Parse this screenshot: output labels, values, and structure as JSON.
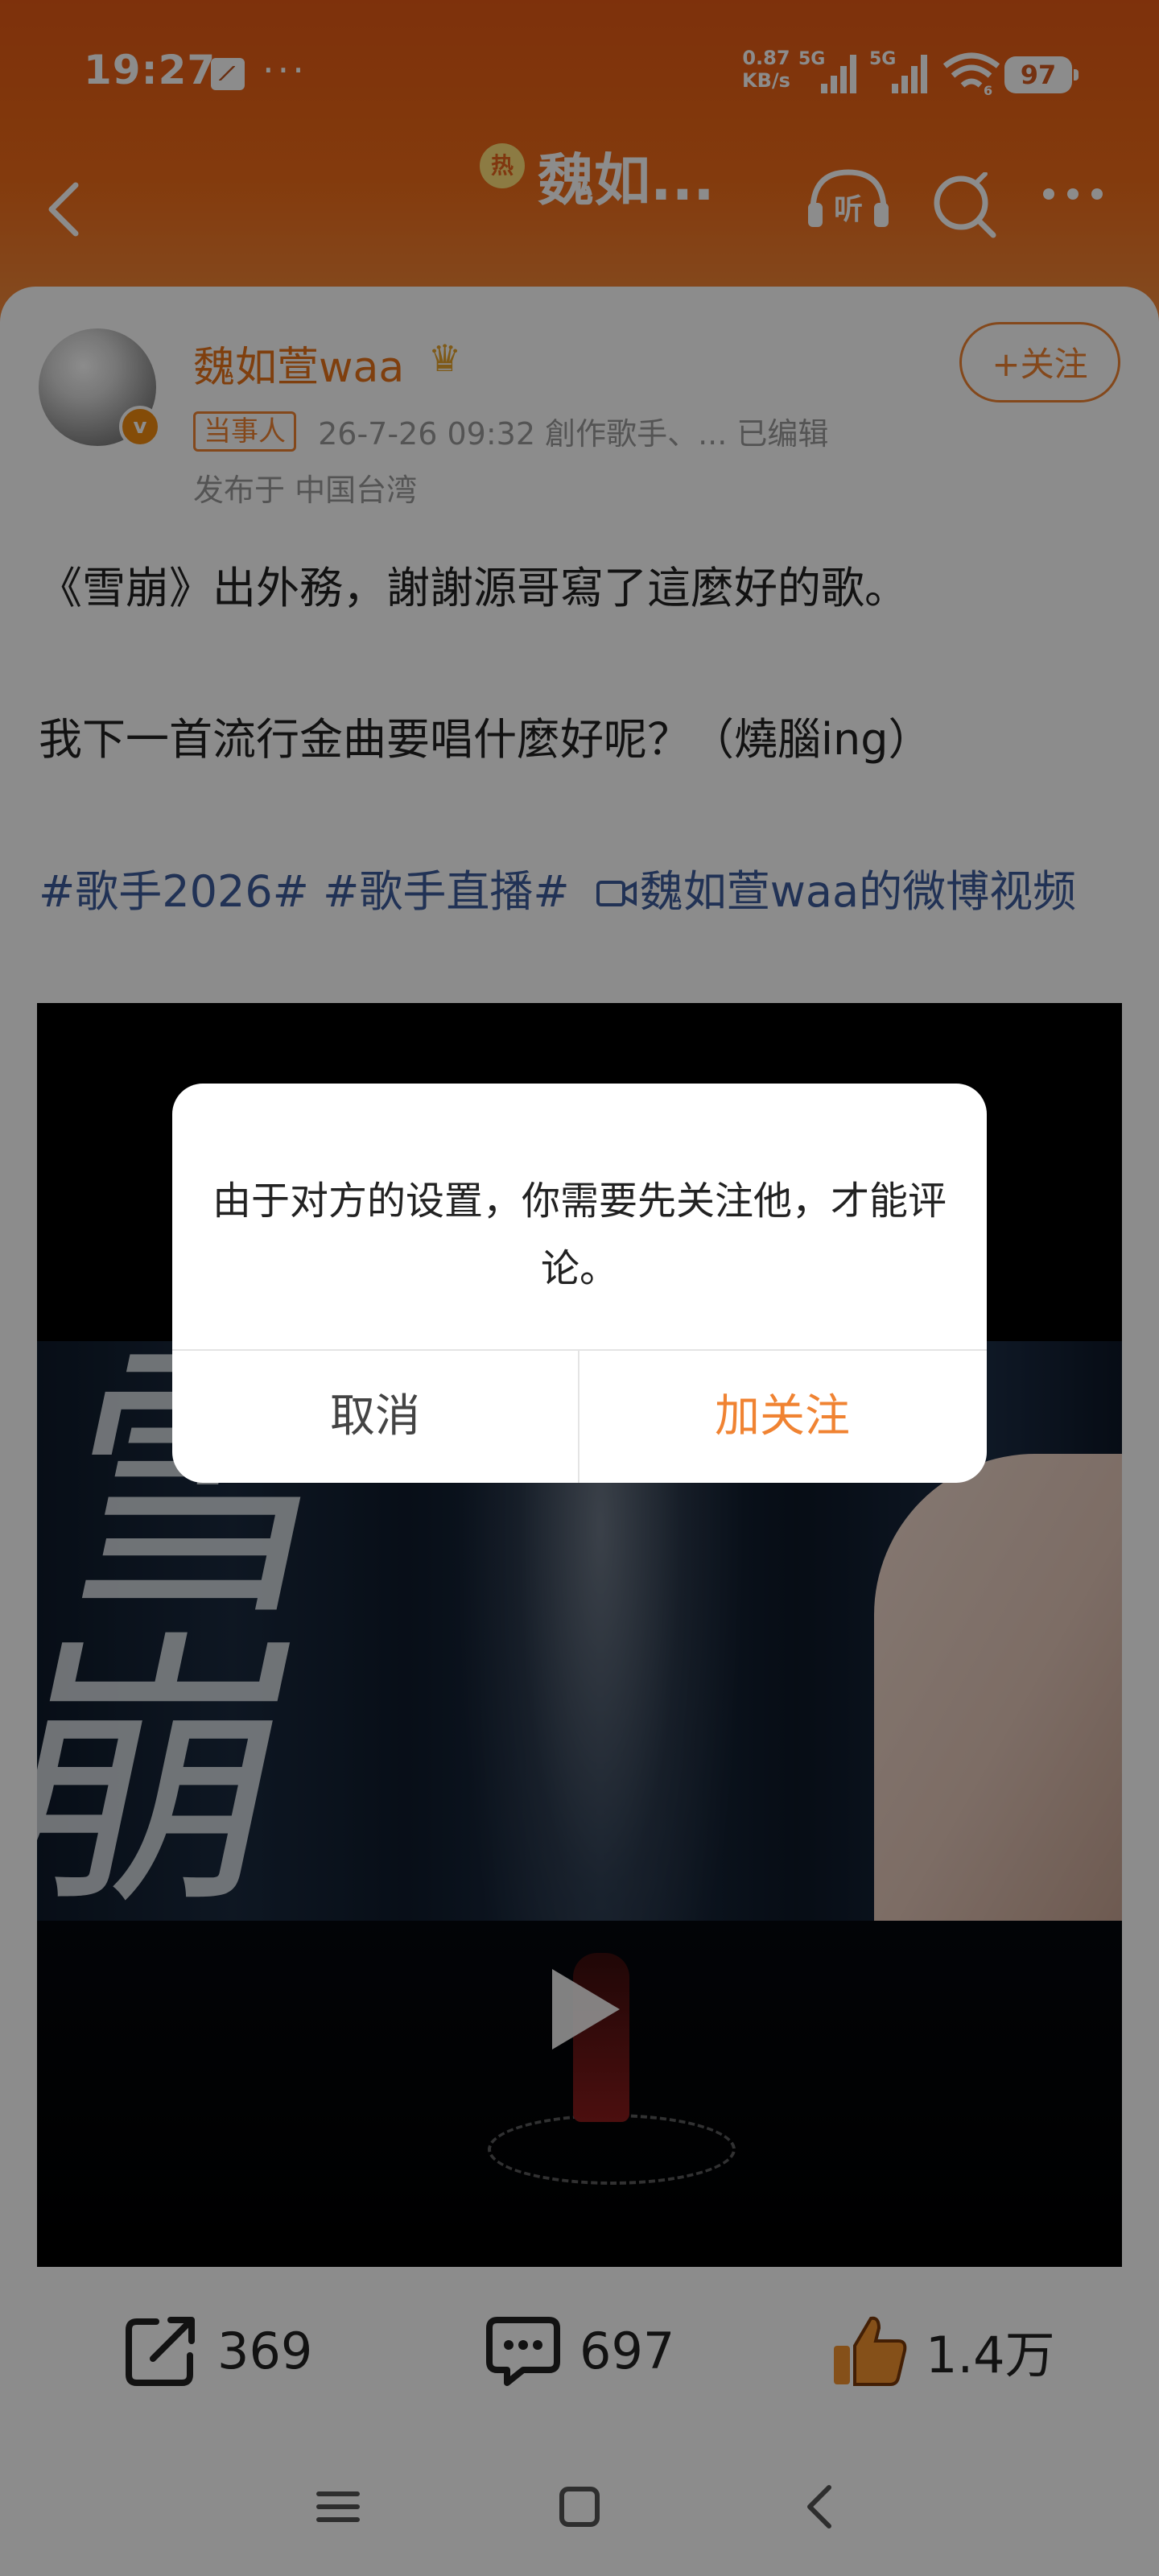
{
  "status_bar": {
    "time": "19:27",
    "more": "···",
    "net_speed_value": "0.87",
    "net_speed_unit": "KB/s",
    "sim1_label": "5G",
    "sim2_label": "5G",
    "wifi_label": "6",
    "battery": "97"
  },
  "nav": {
    "hot_badge": "热",
    "title": "魏如...",
    "listen_label": "听"
  },
  "post": {
    "author": "魏如萱waa",
    "follow_label": "+关注",
    "tag": "当事人",
    "meta": "26-7-26 09:32  創作歌手、...  已编辑",
    "location": "发布于 中国台湾",
    "verified_mark": "v",
    "line1": "《雪崩》出外務，謝謝源哥寫了這麼好的歌。",
    "line2": "我下一首流行金曲要唱什麼好呢？（燒腦ing）",
    "hashtag1": "#歌手2026#",
    "hashtag2": "#歌手直播#",
    "video_link": "魏如萱waa的微博视频",
    "video_glyphs": "雪崩"
  },
  "actions": {
    "repost_count": "369",
    "comment_count": "697",
    "like_count": "1.4万"
  },
  "dialog": {
    "message": "由于对方的设置，你需要先关注他，才能评论。",
    "cancel_label": "取消",
    "confirm_label": "加关注"
  },
  "colors": {
    "accent": "#f08332",
    "header_orange": "#e55a16",
    "link_blue": "#3d5b9c"
  }
}
